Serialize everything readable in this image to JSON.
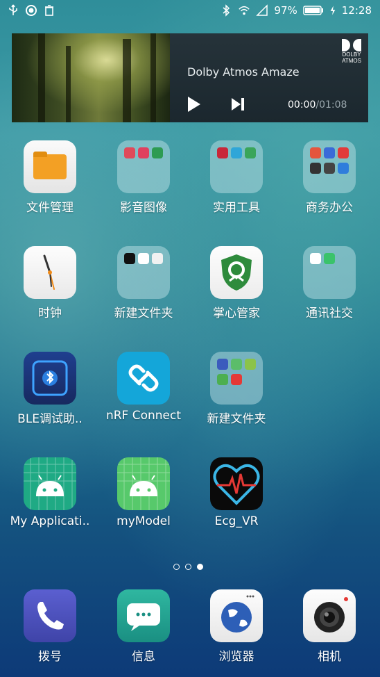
{
  "status_bar": {
    "battery": "97%",
    "time": "12:28"
  },
  "media_widget": {
    "track_title": "Dolby Atmos Amaze",
    "elapsed": "00:00",
    "total": "/01:08",
    "brand_line1": "DOLBY",
    "brand_line2": "ATMOS"
  },
  "apps": [
    {
      "label": "文件管理"
    },
    {
      "label": "影音图像"
    },
    {
      "label": "实用工具"
    },
    {
      "label": "商务办公"
    },
    {
      "label": "时钟"
    },
    {
      "label": "新建文件夹"
    },
    {
      "label": "掌心管家"
    },
    {
      "label": "通讯社交"
    },
    {
      "label": "BLE调试助.."
    },
    {
      "label": "nRF Connect"
    },
    {
      "label": "新建文件夹"
    },
    {
      "label": "My Applicati.."
    },
    {
      "label": "myModel"
    },
    {
      "label": "Ecg_VR"
    }
  ],
  "dock": [
    {
      "label": "拨号"
    },
    {
      "label": "信息"
    },
    {
      "label": "浏览器"
    },
    {
      "label": "相机"
    }
  ],
  "page_indicator": {
    "pages": 3,
    "current": 3
  }
}
